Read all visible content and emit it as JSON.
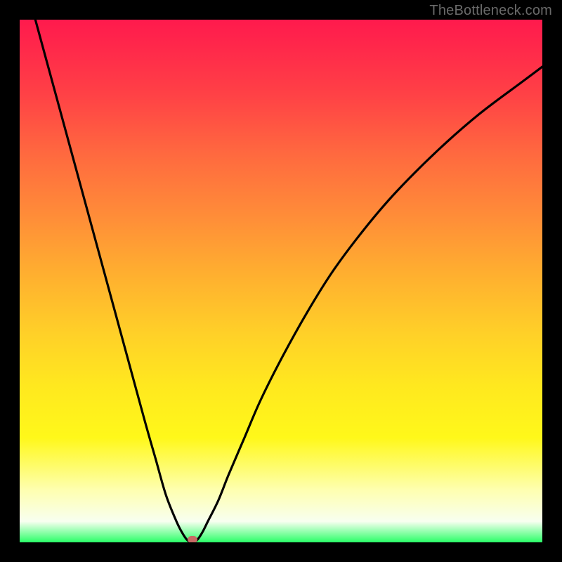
{
  "watermark": "TheBottleneck.com",
  "chart_data": {
    "type": "line",
    "title": "",
    "xlabel": "",
    "ylabel": "",
    "xlim": [
      0,
      100
    ],
    "ylim": [
      0,
      100
    ],
    "grid": false,
    "legend": false,
    "background": "rainbow-gradient",
    "series": [
      {
        "name": "bottleneck-curve",
        "x": [
          3,
          6,
          9,
          12,
          15,
          18,
          21,
          24,
          26,
          28,
          30,
          31,
          32,
          33,
          34,
          35,
          36,
          38,
          40,
          43,
          46,
          50,
          55,
          60,
          66,
          72,
          80,
          88,
          96,
          100
        ],
        "y": [
          100,
          89,
          78,
          67,
          56,
          45,
          34,
          23,
          16,
          9,
          4,
          2,
          0.5,
          0,
          0.5,
          2,
          4,
          8,
          13,
          20,
          27,
          35,
          44,
          52,
          60,
          67,
          75,
          82,
          88,
          91
        ]
      }
    ],
    "marker": {
      "x": 33,
      "y": 0,
      "color": "#c76a64"
    }
  }
}
